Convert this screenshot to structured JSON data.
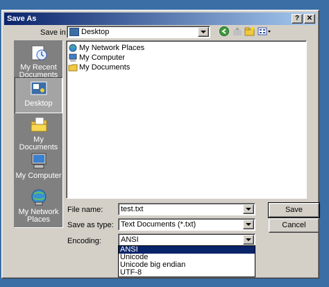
{
  "window": {
    "title": "Save As",
    "help_label": "?",
    "close_label": "✕"
  },
  "save_in": {
    "label": "Save in:",
    "value": "Desktop"
  },
  "places": [
    {
      "label": "My Recent Documents",
      "icon": "recent-documents-icon"
    },
    {
      "label": "Desktop",
      "icon": "desktop-icon"
    },
    {
      "label": "My Documents",
      "icon": "my-documents-icon"
    },
    {
      "label": "My Computer",
      "icon": "my-computer-icon"
    },
    {
      "label": "My Network Places",
      "icon": "network-places-icon"
    }
  ],
  "files": [
    {
      "name": "My Network Places",
      "icon": "network-places-icon"
    },
    {
      "name": "My Computer",
      "icon": "my-computer-icon"
    },
    {
      "name": "My Documents",
      "icon": "folder-icon"
    }
  ],
  "file_name": {
    "label": "File name:",
    "value": "test.txt"
  },
  "save_as_type": {
    "label": "Save as type:",
    "value": "Text Documents (*.txt)"
  },
  "encoding": {
    "label": "Encoding:",
    "value": "ANSI",
    "options": [
      "ANSI",
      "Unicode",
      "Unicode big endian",
      "UTF-8"
    ]
  },
  "buttons": {
    "save": "Save",
    "cancel": "Cancel"
  },
  "colors": {
    "titlebar": "#0a246a",
    "selection": "#0a246a",
    "desktop": "#3a6ea5",
    "face": "#d4d0c8"
  }
}
